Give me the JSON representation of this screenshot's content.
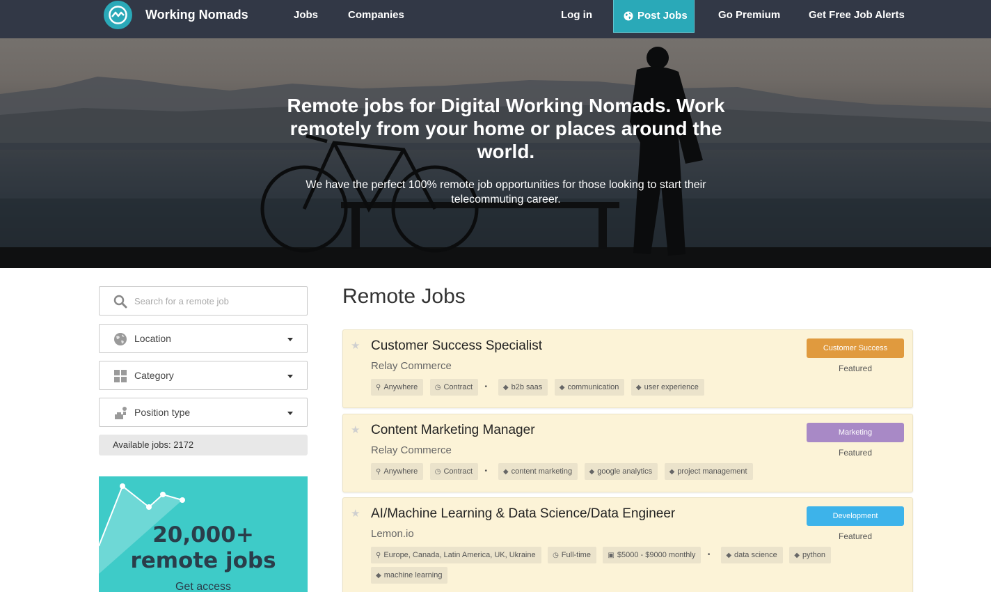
{
  "nav": {
    "brand": "Working Nomads",
    "links": {
      "jobs": "Jobs",
      "companies": "Companies",
      "login": "Log in",
      "post_jobs": "Post Jobs",
      "premium": "Go Premium",
      "alerts": "Get Free Job Alerts"
    },
    "accent_color": "#2aa9b8",
    "background_color": "#323846"
  },
  "hero": {
    "title": "Remote jobs for Digital Working Nomads. Work remotely from your home or places around the world.",
    "subtitle": "We have the perfect 100% remote job opportunities for those looking to start their telecommuting career."
  },
  "sidebar": {
    "search": {
      "placeholder": "Search for a remote job",
      "icon": "search-icon"
    },
    "filters": {
      "location": {
        "label": "Location",
        "icon": "globe-icon"
      },
      "category": {
        "label": "Category",
        "icon": "grid-icon"
      },
      "position": {
        "label": "Position type",
        "icon": "briefcase-icon"
      }
    },
    "available": "Available jobs: 2172",
    "promo": {
      "line1": "20,000+",
      "line2": "remote jobs",
      "cta": "Get access",
      "background_color": "#3ecbc8"
    }
  },
  "main": {
    "title": "Remote Jobs",
    "jobs": [
      {
        "title": "Customer Success Specialist",
        "company": "Relay Commerce",
        "category": "Customer Success",
        "category_color": "#e09a3e",
        "featured": "Featured",
        "meta": [
          "Anywhere",
          "Contract"
        ],
        "tags": [
          "b2b saas",
          "communication",
          "user experience"
        ]
      },
      {
        "title": "Content Marketing Manager",
        "company": "Relay Commerce",
        "category": "Marketing",
        "category_color": "#a889c6",
        "featured": "Featured",
        "meta": [
          "Anywhere",
          "Contract"
        ],
        "tags": [
          "content marketing",
          "google analytics",
          "project management"
        ]
      },
      {
        "title": "AI/Machine Learning & Data Science/Data Engineer",
        "company": "Lemon.io",
        "category": "Development",
        "category_color": "#3db3ea",
        "featured": "Featured",
        "meta": [
          "Europe, Canada, Latin America, UK, Ukraine",
          "Full-time",
          "$5000 - $9000 monthly"
        ],
        "tags": [
          "data science",
          "python",
          "machine learning"
        ]
      }
    ]
  }
}
